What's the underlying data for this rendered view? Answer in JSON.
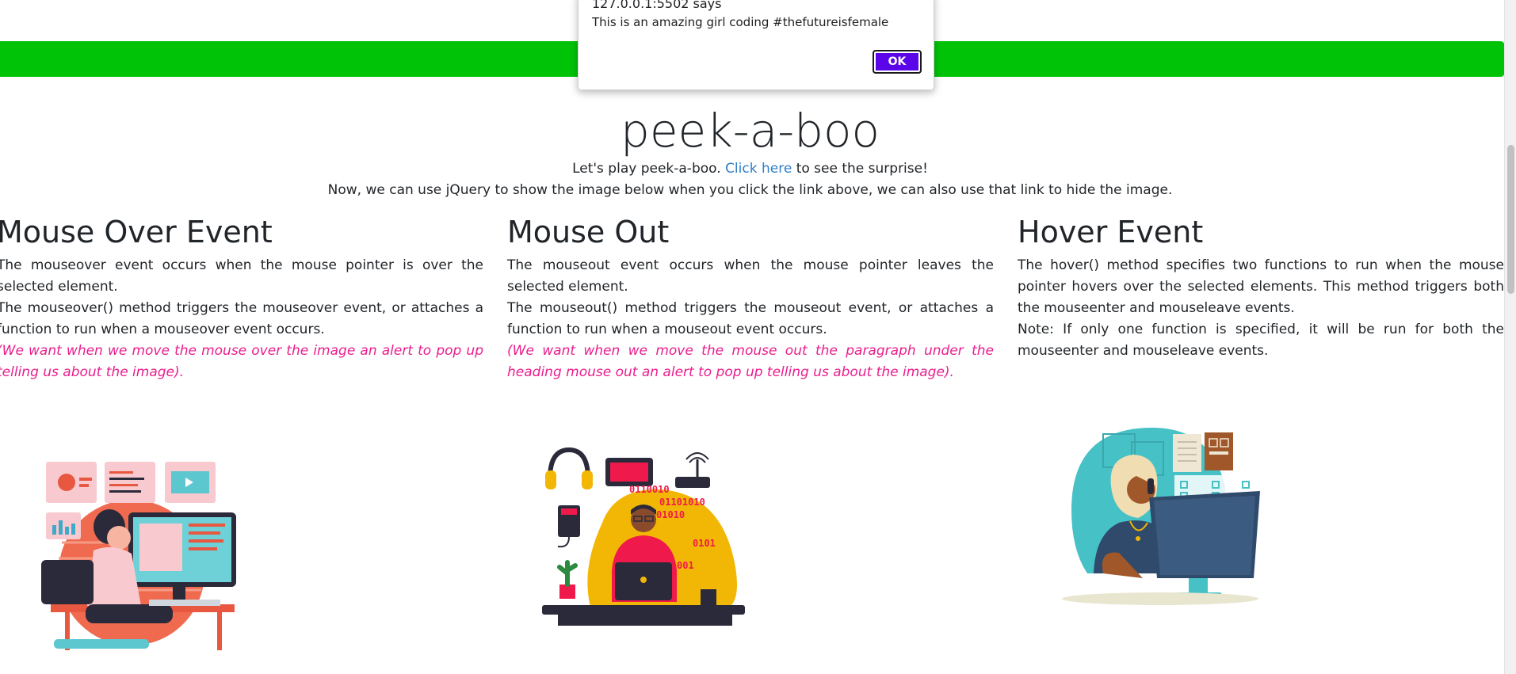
{
  "colors": {
    "banner": "#00c308",
    "accent_text": "#ea1e8e",
    "link": "#2f7ec9",
    "ok_button": "#5a06e8"
  },
  "alert": {
    "origin": "127.0.0.1:5502 says",
    "message": "This is an amazing girl coding #thefutureisfemale",
    "ok_label": "OK"
  },
  "page": {
    "title": "peek-a-boo",
    "intro_prefix": "Let's play peek-a-boo.",
    "intro_link": "Click here",
    "intro_suffix": "to see the surprise!",
    "intro_line2": "Now, we can use jQuery to show the image below when you click the link above, we can also use that link to hide the image."
  },
  "columns": [
    {
      "heading": "Mouse Over Event",
      "p1": "The mouseover event occurs when the mouse pointer is over the selected element.",
      "p2": "The mouseover() method triggers the mouseover event, or attaches a function to run when a mouseover event occurs.",
      "p3": "(We want when we move the mouse over the image an alert to pop up telling us about the image)."
    },
    {
      "heading": "Mouse Out",
      "p1": "The mouseout event occurs when the mouse pointer leaves the selected element.",
      "p2": "The mouseout() method triggers the mouseout event, or attaches a function to run when a mouseout event occurs.",
      "p3": "(We want when we move the mouse out the paragraph under the heading mouse out an alert to pop up telling us about the image)."
    },
    {
      "heading": "Hover Event",
      "p1": "The hover() method specifies two functions to run when the mouse pointer hovers over the selected elements. This method triggers both the mouseenter and mouseleave events.",
      "p2": "Note: If only one function is specified, it will be run for both the mouseenter and mouseleave events."
    }
  ],
  "illustrations": {
    "binary_lines": [
      "0110010",
      "01101010",
      "01010",
      "0101",
      "001"
    ]
  }
}
